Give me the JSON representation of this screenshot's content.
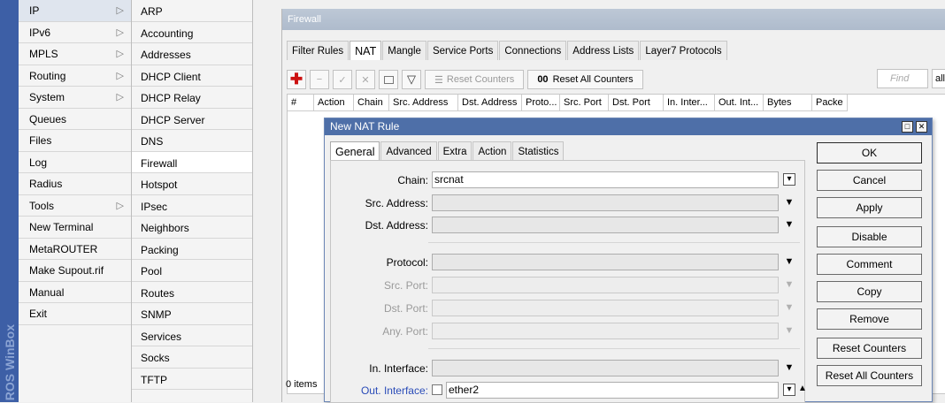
{
  "brand": "ROS WinBox",
  "menu1": [
    {
      "label": "IP",
      "arrow": true,
      "selected": true
    },
    {
      "label": "IPv6",
      "arrow": true
    },
    {
      "label": "MPLS",
      "arrow": true
    },
    {
      "label": "Routing",
      "arrow": true
    },
    {
      "label": "System",
      "arrow": true
    },
    {
      "label": "Queues"
    },
    {
      "label": "Files"
    },
    {
      "label": "Log"
    },
    {
      "label": "Radius"
    },
    {
      "label": "Tools",
      "arrow": true
    },
    {
      "label": "New Terminal"
    },
    {
      "label": "MetaROUTER"
    },
    {
      "label": "Make Supout.rif"
    },
    {
      "label": "Manual"
    },
    {
      "label": "Exit"
    }
  ],
  "menu2": [
    {
      "label": "ARP"
    },
    {
      "label": "Accounting"
    },
    {
      "label": "Addresses"
    },
    {
      "label": "DHCP Client"
    },
    {
      "label": "DHCP Relay"
    },
    {
      "label": "DHCP Server"
    },
    {
      "label": "DNS"
    },
    {
      "label": "Firewall",
      "selected": true
    },
    {
      "label": "Hotspot"
    },
    {
      "label": "IPsec"
    },
    {
      "label": "Neighbors"
    },
    {
      "label": "Packing"
    },
    {
      "label": "Pool"
    },
    {
      "label": "Routes"
    },
    {
      "label": "SNMP"
    },
    {
      "label": "Services"
    },
    {
      "label": "Socks"
    },
    {
      "label": "TFTP"
    }
  ],
  "firewall": {
    "title": "Firewall",
    "tabs": [
      {
        "label": "Filter Rules"
      },
      {
        "label": "NAT",
        "active": true
      },
      {
        "label": "Mangle"
      },
      {
        "label": "Service Ports"
      },
      {
        "label": "Connections"
      },
      {
        "label": "Address Lists"
      },
      {
        "label": "Layer7 Protocols"
      }
    ],
    "toolbar": {
      "reset_counters": "Reset Counters",
      "reset_all_counters_prefix": "00",
      "reset_all_counters": "Reset All Counters",
      "find_placeholder": "Find",
      "filter_value": "all"
    },
    "columns": [
      {
        "label": "#"
      },
      {
        "label": "Action"
      },
      {
        "label": "Chain"
      },
      {
        "label": "Src. Address"
      },
      {
        "label": "Dst. Address"
      },
      {
        "label": "Proto..."
      },
      {
        "label": "Src. Port"
      },
      {
        "label": "Dst. Port"
      },
      {
        "label": "In. Inter..."
      },
      {
        "label": "Out. Int..."
      },
      {
        "label": "Bytes"
      },
      {
        "label": "Packe"
      }
    ],
    "items_count": "0 items"
  },
  "dialog": {
    "title": "New NAT Rule",
    "tabs": [
      {
        "label": "General",
        "active": true
      },
      {
        "label": "Advanced"
      },
      {
        "label": "Extra"
      },
      {
        "label": "Action"
      },
      {
        "label": "Statistics"
      }
    ],
    "fields": {
      "chain": {
        "label": "Chain:",
        "value": "srcnat"
      },
      "src_address": {
        "label": "Src. Address:",
        "value": ""
      },
      "dst_address": {
        "label": "Dst. Address:",
        "value": ""
      },
      "protocol": {
        "label": "Protocol:",
        "value": ""
      },
      "src_port": {
        "label": "Src. Port:",
        "value": ""
      },
      "dst_port": {
        "label": "Dst. Port:",
        "value": ""
      },
      "any_port": {
        "label": "Any. Port:",
        "value": ""
      },
      "in_interface": {
        "label": "In. Interface:",
        "value": ""
      },
      "out_interface": {
        "label": "Out. Interface:",
        "value": "ether2"
      }
    },
    "buttons": {
      "ok": "OK",
      "cancel": "Cancel",
      "apply": "Apply",
      "disable": "Disable",
      "comment": "Comment",
      "copy": "Copy",
      "remove": "Remove",
      "reset_counters": "Reset Counters",
      "reset_all_counters": "Reset All Counters"
    }
  },
  "colors": {
    "titlebar": "#4e6fa8",
    "leftbar": "#3d5fa6",
    "add_icon": "#cc1111"
  }
}
